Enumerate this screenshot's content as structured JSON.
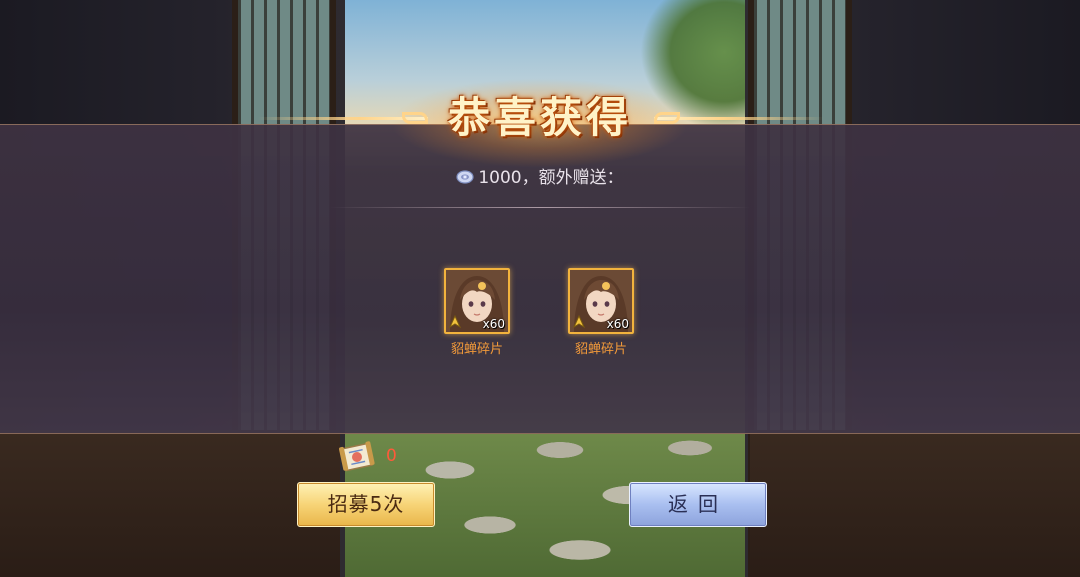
{
  "reward_popup": {
    "title": "恭喜获得",
    "currency_amount": "1000，额外赠送：",
    "items": [
      {
        "name": "貂蝉碎片",
        "count": "x60",
        "icon": "diaochan-portrait-icon"
      },
      {
        "name": "貂蝉碎片",
        "count": "x60",
        "icon": "diaochan-portrait-icon"
      }
    ]
  },
  "recruit_ticket": {
    "icon": "recruit-scroll-icon",
    "count": "0"
  },
  "buttons": {
    "recruit_label": "招募5次",
    "back_label": "返回"
  },
  "colors": {
    "item_name": "#f29a3a",
    "ticket_count": "#ff5a3a",
    "recruit_button": "#f7d477",
    "back_button": "#a9bff0"
  }
}
